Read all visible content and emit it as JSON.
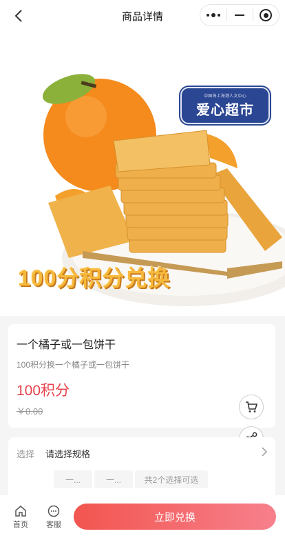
{
  "nav": {
    "title": "商品详情",
    "icons": {
      "back": "chevron-left-icon",
      "more": "more-dots-icon",
      "minimize": "minimize-icon",
      "close": "target-close-icon"
    }
  },
  "hero": {
    "badge_text": "爱心超市",
    "badge_small_text": "中国海上海港人文中心",
    "promo_text": "100分积分兑换",
    "colors": {
      "orange": "#f58a1d",
      "cracker": "#f0b24a",
      "badge": "#2b4693",
      "promo": "#f7b93c"
    }
  },
  "product": {
    "name": "一个橘子或一包饼干",
    "description": "100积分换一个橘子或一包饼干",
    "price": "100积分",
    "original_price": "￥0.00",
    "price_color": "#e8414a"
  },
  "floating": {
    "cart_icon": "cart-icon",
    "share_icon": "share-icon"
  },
  "spec": {
    "label": "选择",
    "value": "请选择规格",
    "options": [
      "一...",
      "一..."
    ],
    "summary": "共2个选择可选"
  },
  "bottom": {
    "tabs": [
      {
        "label": "首页",
        "icon": "home-icon"
      },
      {
        "label": "客服",
        "icon": "chat-icon"
      }
    ],
    "redeem_label": "立即兑换",
    "button_gradient": [
      "#f2554f",
      "#f7808c"
    ]
  }
}
